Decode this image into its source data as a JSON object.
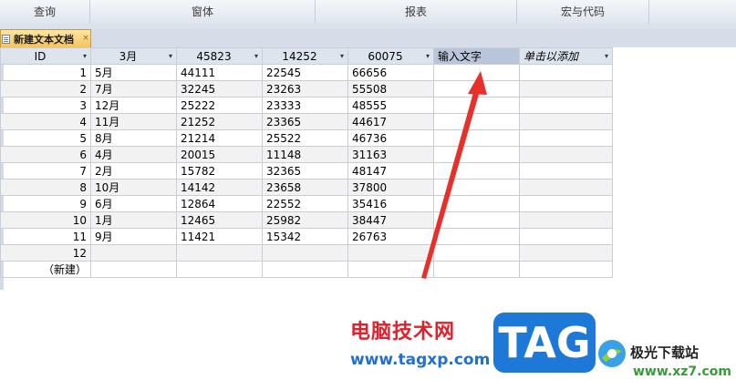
{
  "ribbon": {
    "groups": [
      "查询",
      "窗体",
      "报表",
      "宏与代码"
    ]
  },
  "tab": {
    "label": "新建文本文档",
    "close": "×"
  },
  "table": {
    "columns": [
      {
        "label": "ID",
        "dropdown": "▾"
      },
      {
        "label": "3月",
        "dropdown": "▾"
      },
      {
        "label": "45823",
        "dropdown": "▾"
      },
      {
        "label": "14252",
        "dropdown": "▾"
      },
      {
        "label": "60075",
        "dropdown": "▾"
      },
      {
        "label": "输入文字",
        "dropdown": ""
      },
      {
        "label": "单击以添加",
        "dropdown": "▾"
      }
    ],
    "rows": [
      {
        "id": "1",
        "c1": "5月",
        "c2": "44111",
        "c3": "22545",
        "c4": "66656"
      },
      {
        "id": "2",
        "c1": "7月",
        "c2": "32245",
        "c3": "23263",
        "c4": "55508"
      },
      {
        "id": "3",
        "c1": "12月",
        "c2": "25222",
        "c3": "23333",
        "c4": "48555"
      },
      {
        "id": "4",
        "c1": "11月",
        "c2": "21252",
        "c3": "23365",
        "c4": "44617"
      },
      {
        "id": "5",
        "c1": "8月",
        "c2": "21214",
        "c3": "25522",
        "c4": "46736"
      },
      {
        "id": "6",
        "c1": "4月",
        "c2": "20015",
        "c3": "11148",
        "c4": "31163"
      },
      {
        "id": "7",
        "c1": "2月",
        "c2": "15782",
        "c3": "32365",
        "c4": "48147"
      },
      {
        "id": "8",
        "c1": "10月",
        "c2": "14142",
        "c3": "23658",
        "c4": "37800"
      },
      {
        "id": "9",
        "c1": "6月",
        "c2": "12864",
        "c3": "22552",
        "c4": "35416"
      },
      {
        "id": "10",
        "c1": "1月",
        "c2": "12465",
        "c3": "25982",
        "c4": "38447"
      },
      {
        "id": "11",
        "c1": "9月",
        "c2": "11421",
        "c3": "15342",
        "c4": "26763"
      },
      {
        "id": "12",
        "c1": "",
        "c2": "",
        "c3": "",
        "c4": ""
      }
    ],
    "new_row_label": "（新建）"
  },
  "watermark": {
    "site_cn": "电脑技术网",
    "site_url": "www.tagxp.com",
    "tag_text": "TAG",
    "xz_cn": "极光下载站",
    "xz_url": "www.xz7.com"
  },
  "colors": {
    "accent_tab": "#f6c35a",
    "arrow": "#e8302a",
    "watermark_red": "#e0202a",
    "watermark_blue": "#1f6fd6"
  }
}
